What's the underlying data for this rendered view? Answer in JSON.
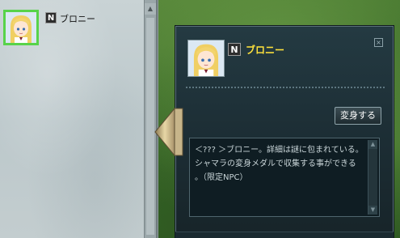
{
  "list": {
    "items": [
      {
        "badge": "N",
        "name": "ブロニー",
        "avatar": "bronie-portrait"
      }
    ]
  },
  "detail": {
    "badge": "N",
    "name": "ブロニー",
    "avatar": "bronie-portrait",
    "close_icon": "×",
    "transform_button": "変身する",
    "description": "＜??? ＞ブロニー。詳細は謎に包まれている。\nシャマラの変身メダルで収集する事ができる\n。（限定NPC）"
  },
  "icons": {
    "list_scroll_up": "▲",
    "desc_scroll_up": "▲",
    "desc_scroll_down": "▼"
  },
  "colors": {
    "name_highlight": "#ffe23c",
    "selection_border": "#58d34a",
    "panel_bg": "#1c2d34"
  }
}
